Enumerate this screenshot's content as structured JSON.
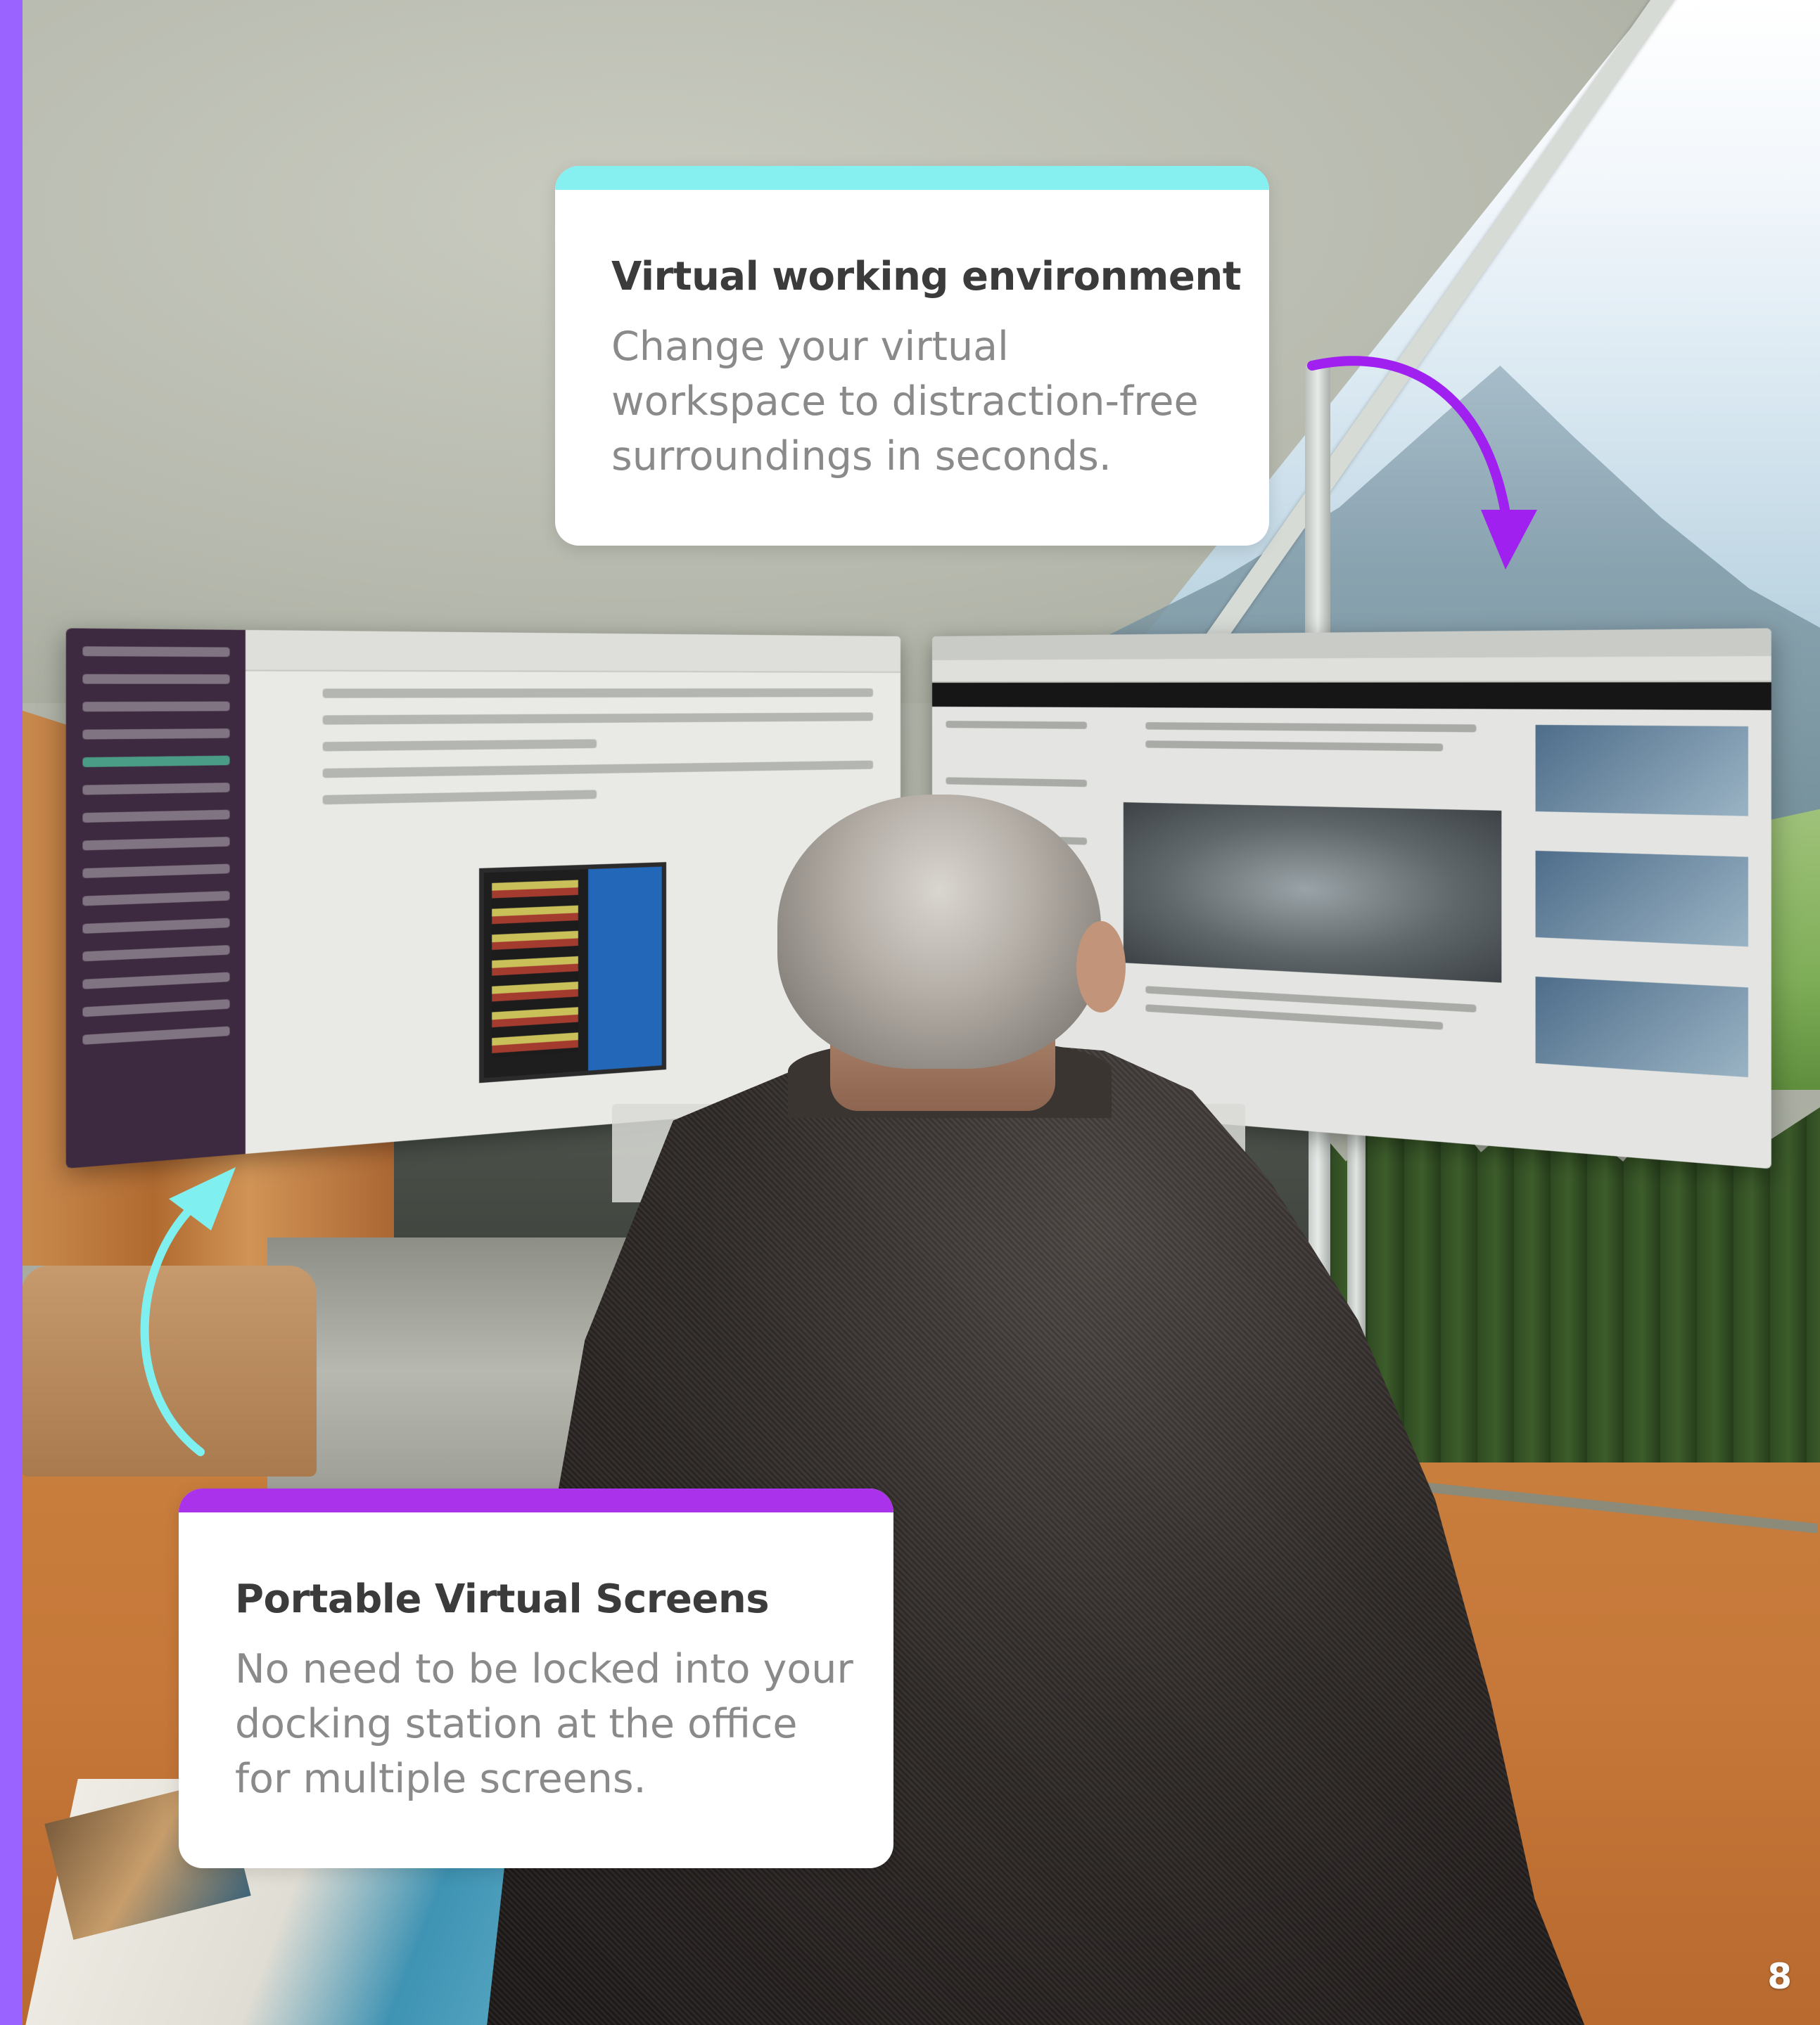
{
  "cards": {
    "top": {
      "title": "Virtual working environment",
      "body": "Change your virtual workspace to distraction-free surroundings in seconds.",
      "accent_color": "#86f0f0"
    },
    "bottom": {
      "title": "Portable Virtual Screens",
      "body": "No need to be locked into your docking station at the office for multiple screens.",
      "accent_color": "#a932ea"
    }
  },
  "arrows": {
    "top_arrow": {
      "icon": "curved-arrow-down-right-icon",
      "color": "#a020f0"
    },
    "bottom_arrow": {
      "icon": "curved-arrow-up-right-icon",
      "color": "#7ff0ef"
    }
  },
  "accent_bar_color": "#9a63ff",
  "page_number": "8"
}
